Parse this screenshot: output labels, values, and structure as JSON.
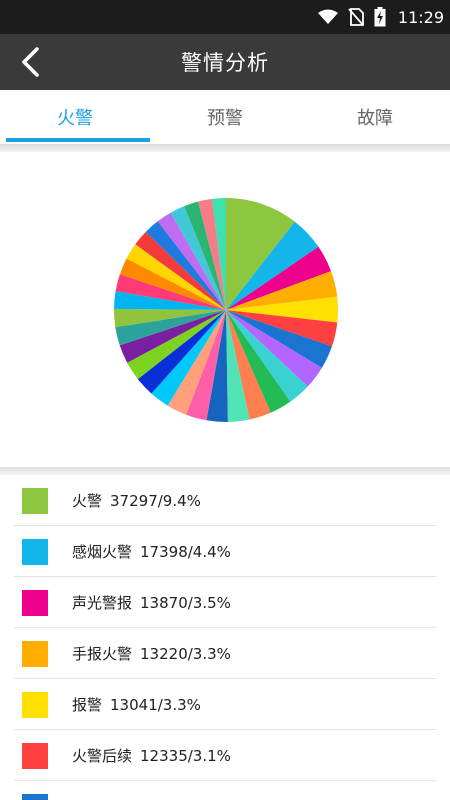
{
  "status_bar": {
    "time": "11:29",
    "icons": [
      "wifi-icon",
      "no-sim-icon",
      "battery-charging-icon"
    ]
  },
  "header": {
    "title": "警情分析",
    "back_icon": "chevron-left-icon"
  },
  "tabs": [
    {
      "label": "火警",
      "active": true
    },
    {
      "label": "预警",
      "active": false
    },
    {
      "label": "故障",
      "active": false
    }
  ],
  "chart_data": {
    "type": "pie",
    "slices": [
      {
        "label": "火警",
        "value": 37297,
        "percent": "9.4%",
        "color": "#8dc63f"
      },
      {
        "label": "感烟火警",
        "value": 17398,
        "percent": "4.4%",
        "color": "#13b5ea"
      },
      {
        "label": "声光警报",
        "value": 13870,
        "percent": "3.5%",
        "color": "#ec008c"
      },
      {
        "label": "手报火警",
        "value": 13220,
        "percent": "3.3%",
        "color": "#ffae00"
      },
      {
        "label": "报警",
        "value": 13041,
        "percent": "3.3%",
        "color": "#ffe000"
      },
      {
        "label": "火警后续",
        "value": 12335,
        "percent": "3.1%",
        "color": "#ff4040"
      },
      {
        "value": 12000,
        "color": "#1b75d0"
      },
      {
        "value": 11800,
        "color": "#b266ff"
      },
      {
        "value": 11600,
        "color": "#3ad1d1"
      },
      {
        "value": 11400,
        "color": "#22bb55"
      },
      {
        "value": 11200,
        "color": "#ff7f50"
      },
      {
        "value": 11000,
        "color": "#4fe3b5"
      },
      {
        "value": 10800,
        "color": "#1564c0"
      },
      {
        "value": 10600,
        "color": "#ff5ea8"
      },
      {
        "value": 10400,
        "color": "#ffa07a"
      },
      {
        "value": 10200,
        "color": "#00c8f8"
      },
      {
        "value": 10000,
        "color": "#0a2fd8"
      },
      {
        "value": 9800,
        "color": "#7ed321"
      },
      {
        "value": 9600,
        "color": "#7a1fa2"
      },
      {
        "value": 9400,
        "color": "#2ba39a"
      },
      {
        "value": 9200,
        "color": "#90c43c"
      },
      {
        "value": 9000,
        "color": "#00b4f0"
      },
      {
        "value": 8800,
        "color": "#ff3b77"
      },
      {
        "value": 8600,
        "color": "#ff8a00"
      },
      {
        "value": 8400,
        "color": "#ffd500"
      },
      {
        "value": 8200,
        "color": "#f33b3b"
      },
      {
        "value": 8000,
        "color": "#1f7be0"
      },
      {
        "value": 7800,
        "color": "#c06cf0"
      },
      {
        "value": 7600,
        "color": "#42c8d8"
      },
      {
        "value": 7400,
        "color": "#2bb573"
      },
      {
        "value": 7200,
        "color": "#f57d88"
      },
      {
        "value": 7000,
        "color": "#3fe0b0"
      }
    ]
  },
  "legend": [
    {
      "name": "火警",
      "value": "37297/9.4%",
      "color": "#8dc63f"
    },
    {
      "name": "感烟火警",
      "value": "17398/4.4%",
      "color": "#13b5ea"
    },
    {
      "name": "声光警报",
      "value": "13870/3.5%",
      "color": "#ec008c"
    },
    {
      "name": "手报火警",
      "value": "13220/3.3%",
      "color": "#ffae00"
    },
    {
      "name": "报警",
      "value": "13041/3.3%",
      "color": "#ffe000"
    },
    {
      "name": "火警后续",
      "value": "12335/3.1%",
      "color": "#ff4040"
    },
    {
      "name": "",
      "value": "",
      "color": "#1b75d0"
    }
  ]
}
